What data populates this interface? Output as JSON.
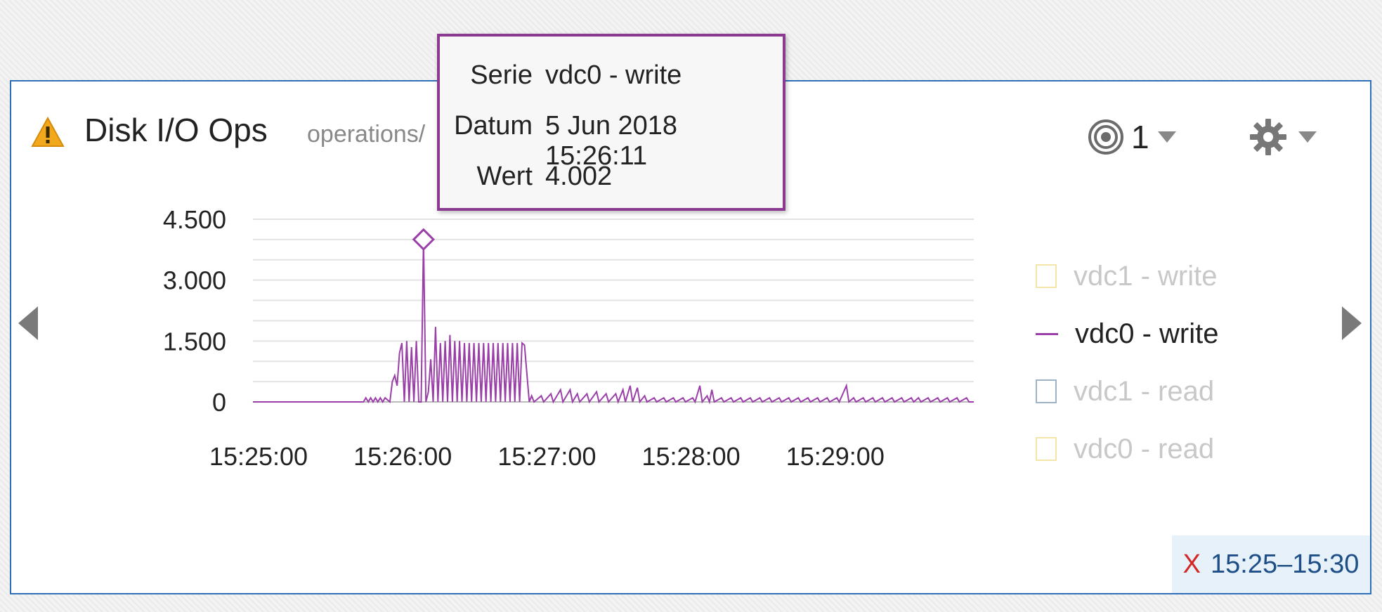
{
  "panel": {
    "title": "Disk I/O Ops",
    "subtitle": "operations/",
    "target_count": "1",
    "time_range": "15:25–15:30",
    "time_range_clear": "X"
  },
  "tooltip": {
    "series_key": "Serie",
    "series_value": "vdc0 - write",
    "date_key": "Datum",
    "date_value": "5 Jun 2018 15:26:11",
    "value_key": "Wert",
    "value_value": "4.002"
  },
  "legend": [
    {
      "label": "vdc1 - write",
      "color": "#f3e6a8",
      "active": false
    },
    {
      "label": "vdc0 - write",
      "color": "#9a3fa8",
      "active": true
    },
    {
      "label": "vdc1 - read",
      "color": "#9fb3c8",
      "active": false
    },
    {
      "label": "vdc0 - read",
      "color": "#f3e6a8",
      "active": false
    }
  ],
  "icons": {
    "warning": "warning-icon",
    "target": "target-icon",
    "gear": "gear-icon",
    "nav_prev": "chevron-left-icon",
    "nav_next": "chevron-right-icon"
  },
  "chart_data": {
    "type": "line",
    "y_ticks": [
      "4.500",
      "3.000",
      "1.500",
      "0"
    ],
    "y_tick_values": [
      4500,
      3000,
      1500,
      0
    ],
    "x_ticks": [
      "15:25:00",
      "15:26:00",
      "15:27:00",
      "15:28:00",
      "15:29:00"
    ],
    "x_tick_seconds": [
      0,
      60,
      120,
      180,
      240
    ],
    "ylim": [
      0,
      4500
    ],
    "xlim_seconds": [
      0,
      300
    ],
    "grid": true,
    "legend_placement": "right",
    "highlight": {
      "series": "vdc0 - write",
      "x_seconds": 71,
      "value": 4002
    },
    "series": [
      {
        "name": "vdc0 - write",
        "color": "#9a3fa8",
        "points": [
          [
            0,
            0
          ],
          [
            46,
            0
          ],
          [
            47,
            100
          ],
          [
            48,
            0
          ],
          [
            49,
            100
          ],
          [
            50,
            0
          ],
          [
            51,
            100
          ],
          [
            52,
            0
          ],
          [
            53,
            100
          ],
          [
            54,
            0
          ],
          [
            55,
            100
          ],
          [
            57,
            0
          ],
          [
            58,
            500
          ],
          [
            59,
            650
          ],
          [
            60,
            400
          ],
          [
            61,
            1200
          ],
          [
            62,
            1450
          ],
          [
            63,
            0
          ],
          [
            64,
            1500
          ],
          [
            65,
            0
          ],
          [
            66,
            1350
          ],
          [
            67,
            0
          ],
          [
            68,
            1500
          ],
          [
            69,
            0
          ],
          [
            70,
            0
          ],
          [
            71,
            4002
          ],
          [
            72,
            0
          ],
          [
            73,
            250
          ],
          [
            74,
            1050
          ],
          [
            75,
            0
          ],
          [
            76,
            1850
          ],
          [
            77,
            0
          ],
          [
            78,
            1450
          ],
          [
            79,
            0
          ],
          [
            80,
            1500
          ],
          [
            81,
            0
          ],
          [
            82,
            1650
          ],
          [
            83,
            0
          ],
          [
            84,
            1500
          ],
          [
            85,
            0
          ],
          [
            86,
            1500
          ],
          [
            87,
            0
          ],
          [
            88,
            1450
          ],
          [
            89,
            0
          ],
          [
            90,
            1450
          ],
          [
            91,
            0
          ],
          [
            92,
            1450
          ],
          [
            93,
            0
          ],
          [
            94,
            1450
          ],
          [
            95,
            0
          ],
          [
            96,
            1450
          ],
          [
            97,
            0
          ],
          [
            98,
            1450
          ],
          [
            99,
            0
          ],
          [
            100,
            1450
          ],
          [
            101,
            0
          ],
          [
            102,
            1450
          ],
          [
            103,
            0
          ],
          [
            104,
            1450
          ],
          [
            105,
            0
          ],
          [
            106,
            1450
          ],
          [
            107,
            0
          ],
          [
            108,
            1450
          ],
          [
            109,
            0
          ],
          [
            110,
            1450
          ],
          [
            111,
            0
          ],
          [
            112,
            1450
          ],
          [
            113,
            1400
          ],
          [
            115,
            0
          ],
          [
            116,
            150
          ],
          [
            117,
            0
          ],
          [
            120,
            150
          ],
          [
            121,
            0
          ],
          [
            124,
            200
          ],
          [
            125,
            0
          ],
          [
            128,
            300
          ],
          [
            129,
            0
          ],
          [
            132,
            300
          ],
          [
            133,
            0
          ],
          [
            135,
            200
          ],
          [
            136,
            0
          ],
          [
            139,
            200
          ],
          [
            140,
            0
          ],
          [
            143,
            250
          ],
          [
            144,
            0
          ],
          [
            147,
            200
          ],
          [
            148,
            0
          ],
          [
            151,
            200
          ],
          [
            152,
            0
          ],
          [
            154,
            300
          ],
          [
            155,
            0
          ],
          [
            157,
            400
          ],
          [
            158,
            0
          ],
          [
            160,
            350
          ],
          [
            161,
            0
          ],
          [
            163,
            150
          ],
          [
            164,
            0
          ],
          [
            167,
            100
          ],
          [
            168,
            0
          ],
          [
            171,
            100
          ],
          [
            172,
            0
          ],
          [
            175,
            100
          ],
          [
            176,
            0
          ],
          [
            179,
            100
          ],
          [
            180,
            0
          ],
          [
            183,
            100
          ],
          [
            184,
            0
          ],
          [
            186,
            400
          ],
          [
            187,
            0
          ],
          [
            189,
            150
          ],
          [
            190,
            0
          ],
          [
            191,
            300
          ],
          [
            192,
            0
          ],
          [
            195,
            100
          ],
          [
            196,
            0
          ],
          [
            199,
            100
          ],
          [
            200,
            0
          ],
          [
            203,
            100
          ],
          [
            204,
            0
          ],
          [
            207,
            100
          ],
          [
            208,
            0
          ],
          [
            211,
            100
          ],
          [
            212,
            0
          ],
          [
            215,
            100
          ],
          [
            216,
            0
          ],
          [
            219,
            100
          ],
          [
            220,
            0
          ],
          [
            223,
            100
          ],
          [
            224,
            0
          ],
          [
            227,
            100
          ],
          [
            228,
            0
          ],
          [
            231,
            100
          ],
          [
            232,
            0
          ],
          [
            235,
            100
          ],
          [
            236,
            0
          ],
          [
            239,
            100
          ],
          [
            240,
            0
          ],
          [
            243,
            100
          ],
          [
            244,
            0
          ],
          [
            247,
            400
          ],
          [
            248,
            0
          ],
          [
            250,
            100
          ],
          [
            251,
            0
          ],
          [
            254,
            100
          ],
          [
            255,
            0
          ],
          [
            258,
            100
          ],
          [
            259,
            0
          ],
          [
            262,
            100
          ],
          [
            263,
            0
          ],
          [
            266,
            100
          ],
          [
            267,
            0
          ],
          [
            270,
            100
          ],
          [
            271,
            0
          ],
          [
            274,
            100
          ],
          [
            275,
            0
          ],
          [
            277,
            100
          ],
          [
            278,
            0
          ],
          [
            281,
            100
          ],
          [
            282,
            0
          ],
          [
            285,
            100
          ],
          [
            286,
            0
          ],
          [
            289,
            100
          ],
          [
            290,
            0
          ],
          [
            293,
            100
          ],
          [
            294,
            0
          ],
          [
            297,
            100
          ],
          [
            298,
            0
          ],
          [
            300,
            0
          ]
        ]
      }
    ]
  }
}
